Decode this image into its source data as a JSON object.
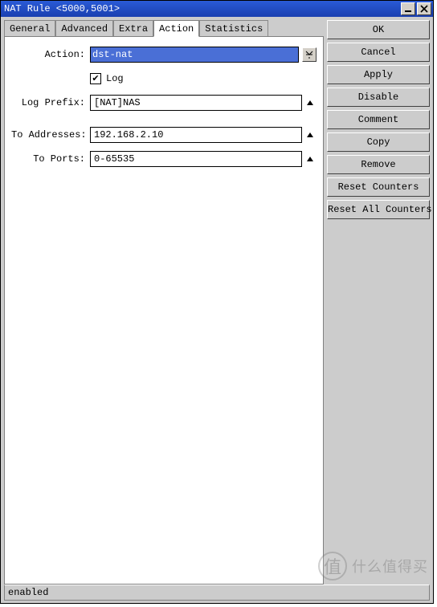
{
  "window": {
    "title": "NAT Rule <5000,5001>"
  },
  "tabs": [
    {
      "label": "General"
    },
    {
      "label": "Advanced"
    },
    {
      "label": "Extra"
    },
    {
      "label": "Action"
    },
    {
      "label": "Statistics"
    }
  ],
  "active_tab": 3,
  "form": {
    "action_label": "Action:",
    "action_value": "dst-nat",
    "log_checked": true,
    "log_label": "Log",
    "log_prefix_label": "Log Prefix:",
    "log_prefix_value": "[NAT]NAS",
    "to_addresses_label": "To Addresses:",
    "to_addresses_value": "192.168.2.10",
    "to_ports_label": "To Ports:",
    "to_ports_value": "0-65535"
  },
  "buttons": {
    "ok": "OK",
    "cancel": "Cancel",
    "apply": "Apply",
    "disable": "Disable",
    "comment": "Comment",
    "copy": "Copy",
    "remove": "Remove",
    "reset_counters": "Reset Counters",
    "reset_all_counters": "Reset All Counters"
  },
  "status": {
    "text": "enabled"
  },
  "watermark": {
    "circle": "值",
    "text": "什么值得买"
  }
}
